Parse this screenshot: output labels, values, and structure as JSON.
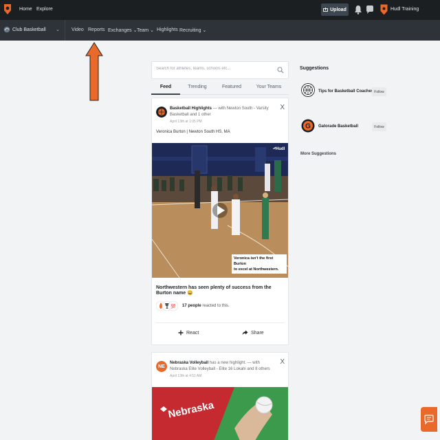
{
  "topbar": {
    "nav": [
      "Home",
      "Explore"
    ],
    "upload_label": "Upload",
    "team_name": "Hudl Training",
    "colors": {
      "bar": "#1b1f22",
      "accent": "#e8692a"
    }
  },
  "subnav": {
    "club_name": "Club Basketball",
    "items": [
      "Video",
      "Reports",
      "Exchanges",
      "Team",
      "Highlights",
      "Recruiting"
    ]
  },
  "search": {
    "placeholder": "Search for athletes, teams, schools etc..."
  },
  "tabs": [
    "Feed",
    "Trending",
    "Featured",
    "Your Teams"
  ],
  "feed": [
    {
      "author": "Basketball Highlights",
      "with_prefix": "— with",
      "with": "Newton South - Varsity Basketball",
      "and": "and",
      "others": "1 other",
      "time": "April 13th at 1:05 PM",
      "subtitle": "Veronica Burton | Newton South HS, MA",
      "caption_line1": "Veronica isn't the first Burton",
      "caption_line2": "to excel at Northwestern.",
      "watermark": "Hudl",
      "title": "Northwestern has seen plenty of success from the Burton name 😄",
      "reactions_count": "17 people",
      "reactions_text": "reacted to this.",
      "react_label": "React",
      "share_label": "Share",
      "close": "X"
    },
    {
      "author": "Nebraska Volleyball",
      "action": "has a new highlight.",
      "with_prefix": "— with",
      "with": "Nebraska Elite Volleyball - Elite 16 Lokahi",
      "and": "and",
      "others": "8 others",
      "time": "April 13th at 4:51 AM",
      "avatar_text": "NE",
      "banner_text": "Nebraska",
      "close": "X"
    }
  ],
  "suggestions": {
    "title": "Suggestions",
    "items": [
      {
        "name": "Tips for Basketball Coaches",
        "follow": "Follow",
        "icon": "basketball-icon"
      },
      {
        "name": "Gatorade Basketball",
        "follow": "Follow",
        "icon": "gatorade-g-icon"
      }
    ],
    "more": "More Suggestions"
  }
}
